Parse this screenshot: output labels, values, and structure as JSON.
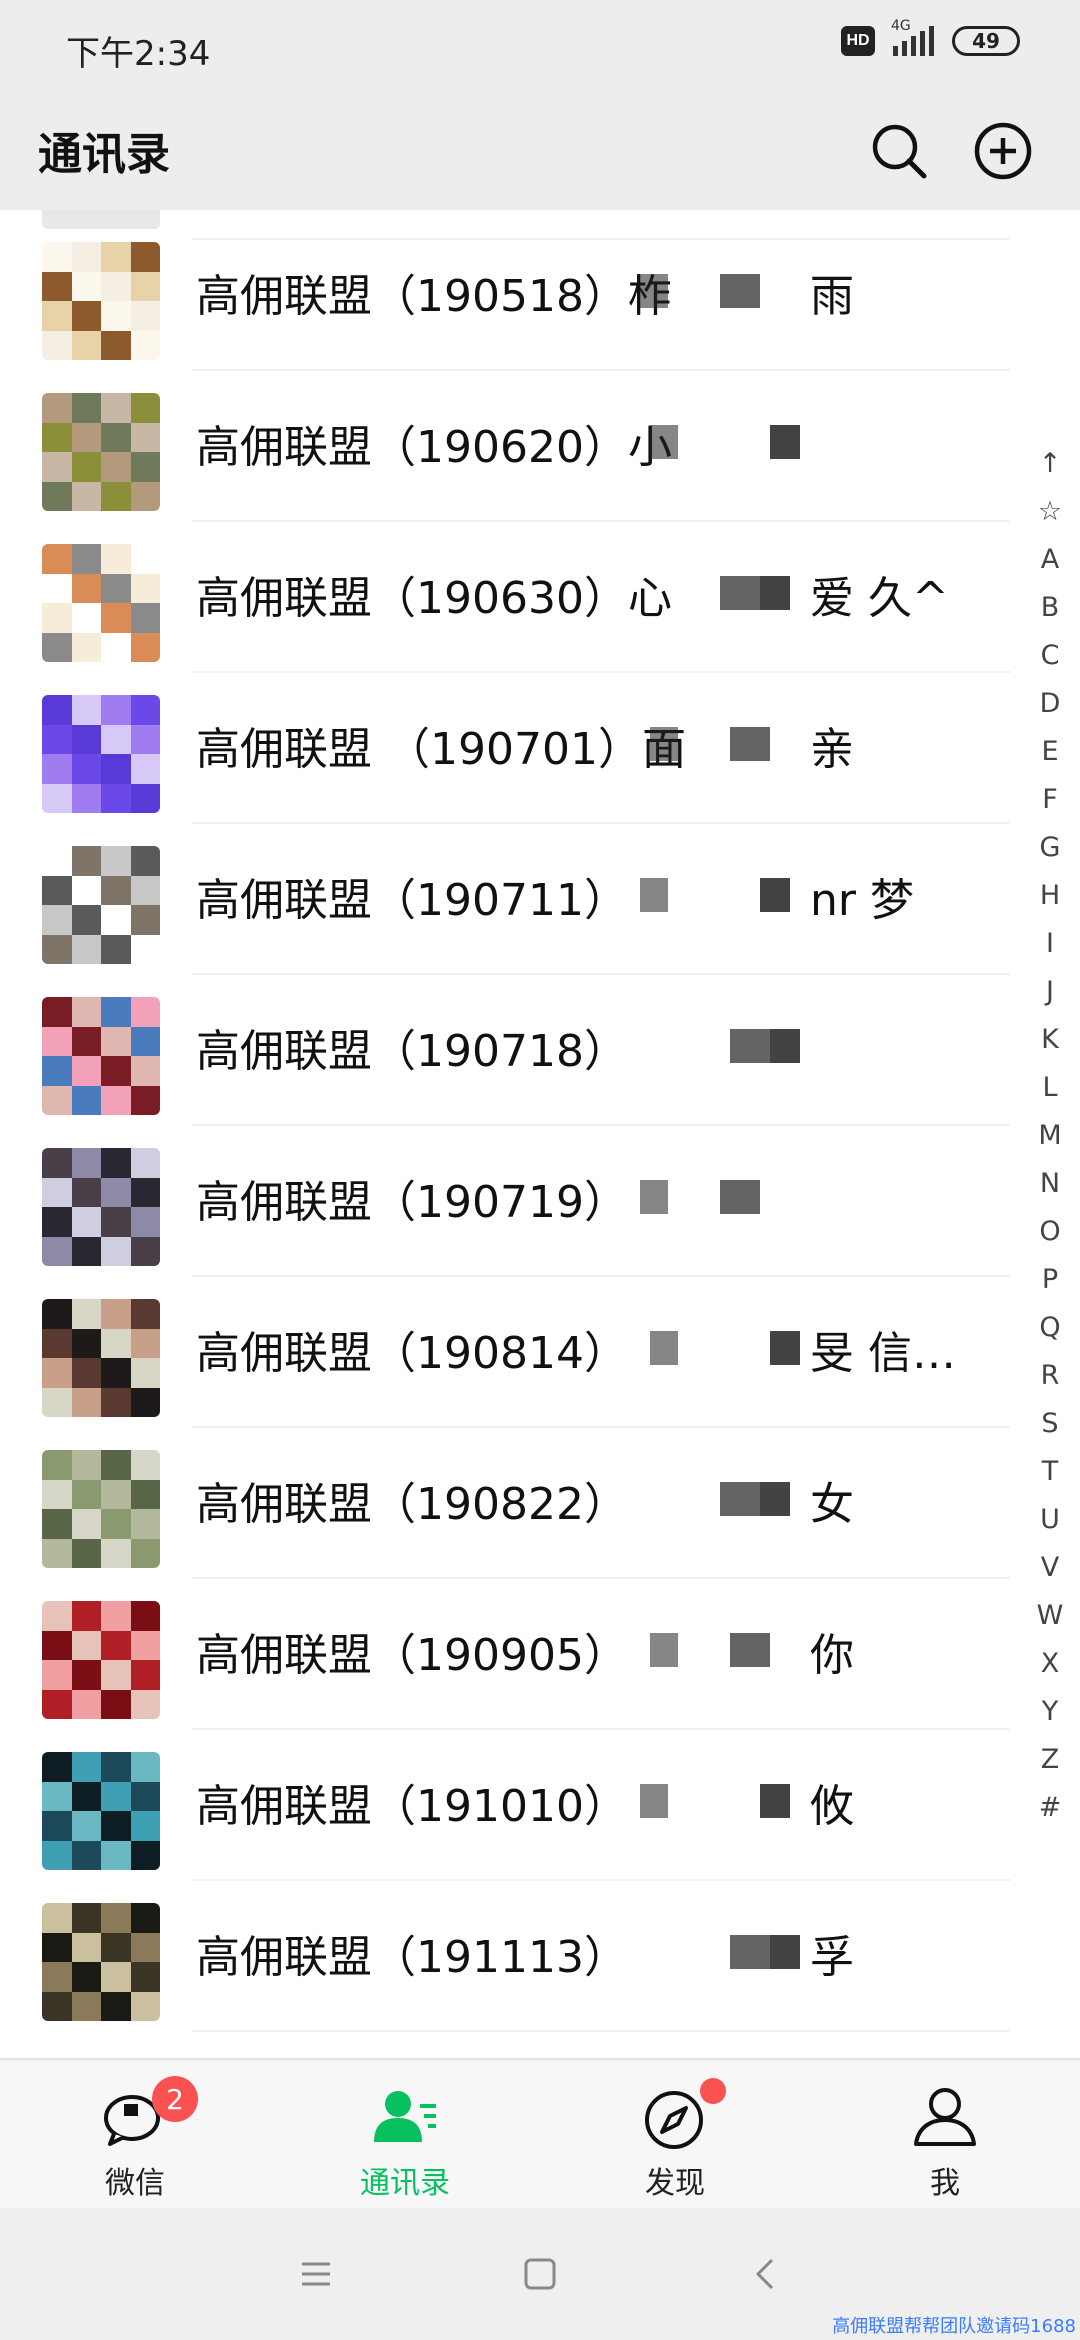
{
  "status_bar": {
    "time": "下午2:34",
    "hd": "HD",
    "network": "4G",
    "battery": "49"
  },
  "header": {
    "title": "通讯录",
    "search_icon": "search-icon",
    "add_icon": "add-circle-icon"
  },
  "contacts": [
    {
      "name": "高佣联盟（190518）柞",
      "tail": "雨",
      "avatar_colors": [
        "#fbf7ec",
        "#8c5a2c",
        "#e8d3a8",
        "#f4efe2"
      ]
    },
    {
      "name": "高佣联盟（190620）小",
      "tail": "",
      "avatar_colors": [
        "#6f7a5a",
        "#b49a7c",
        "#8b8f3a",
        "#c9b7a5"
      ]
    },
    {
      "name": "高佣联盟（190630）心",
      "tail": "爱 久^",
      "avatar_colors": [
        "#f6ecd9",
        "#8a8a8a",
        "#d98c55",
        "#ffffff"
      ]
    },
    {
      "name": "高佣联盟 （190701）面",
      "tail": "亲",
      "avatar_colors": [
        "#6b48e8",
        "#9f7cf0",
        "#d7c9f7",
        "#5a3ad6"
      ]
    },
    {
      "name": "高佣联盟（190711）",
      "tail": "nr 梦",
      "avatar_colors": [
        "#ffffff",
        "#5a5a5a",
        "#c8c8c8",
        "#7e7468"
      ]
    },
    {
      "name": "高佣联盟（190718）",
      "tail": "",
      "avatar_colors": [
        "#dfb6b0",
        "#7a1c24",
        "#f2a1b8",
        "#4a7bbd"
      ]
    },
    {
      "name": "高佣联盟（190719）",
      "tail": "",
      "avatar_colors": [
        "#2a2733",
        "#8c8aa6",
        "#4a3e48",
        "#cfcde0"
      ]
    },
    {
      "name": "高佣联盟（190814）",
      "tail": "旻 信…",
      "avatar_colors": [
        "#5a3a30",
        "#c8a08a",
        "#d8d6c4",
        "#1e1a1a"
      ]
    },
    {
      "name": "高佣联盟（190822）",
      "tail": "女",
      "avatar_colors": [
        "#8a9a6e",
        "#d6d6c8",
        "#5a6648",
        "#b4b89c"
      ]
    },
    {
      "name": "高佣联盟（190905）",
      "tail": "你",
      "avatar_colors": [
        "#b01e26",
        "#e6c2b8",
        "#7a0e14",
        "#f0a0a0"
      ]
    },
    {
      "name": "高佣联盟（191010）",
      "tail": "攸",
      "avatar_colors": [
        "#1c4a5a",
        "#3fa0b4",
        "#0e1c24",
        "#6ab8c4"
      ]
    },
    {
      "name": "高佣联盟（191113）",
      "tail": "孚",
      "avatar_colors": [
        "#1a1a14",
        "#8a7a5a",
        "#3a3424",
        "#cac0a0"
      ]
    }
  ],
  "index_letters": [
    "↑",
    "☆",
    "A",
    "B",
    "C",
    "D",
    "E",
    "F",
    "G",
    "H",
    "I",
    "J",
    "K",
    "L",
    "M",
    "N",
    "O",
    "P",
    "Q",
    "R",
    "S",
    "T",
    "U",
    "V",
    "W",
    "X",
    "Y",
    "Z",
    "#"
  ],
  "tabs": [
    {
      "label": "微信",
      "icon": "chat-bubble-icon",
      "badge": "2"
    },
    {
      "label": "通讯录",
      "icon": "contacts-icon",
      "active": true
    },
    {
      "label": "发现",
      "icon": "compass-icon",
      "dot": true
    },
    {
      "label": "我",
      "icon": "person-icon"
    }
  ],
  "colors": {
    "accent": "#07c160",
    "badge": "#fa5151",
    "header_bg": "#ededed"
  },
  "watermark": "高佣联盟帮帮团队邀请码1688"
}
